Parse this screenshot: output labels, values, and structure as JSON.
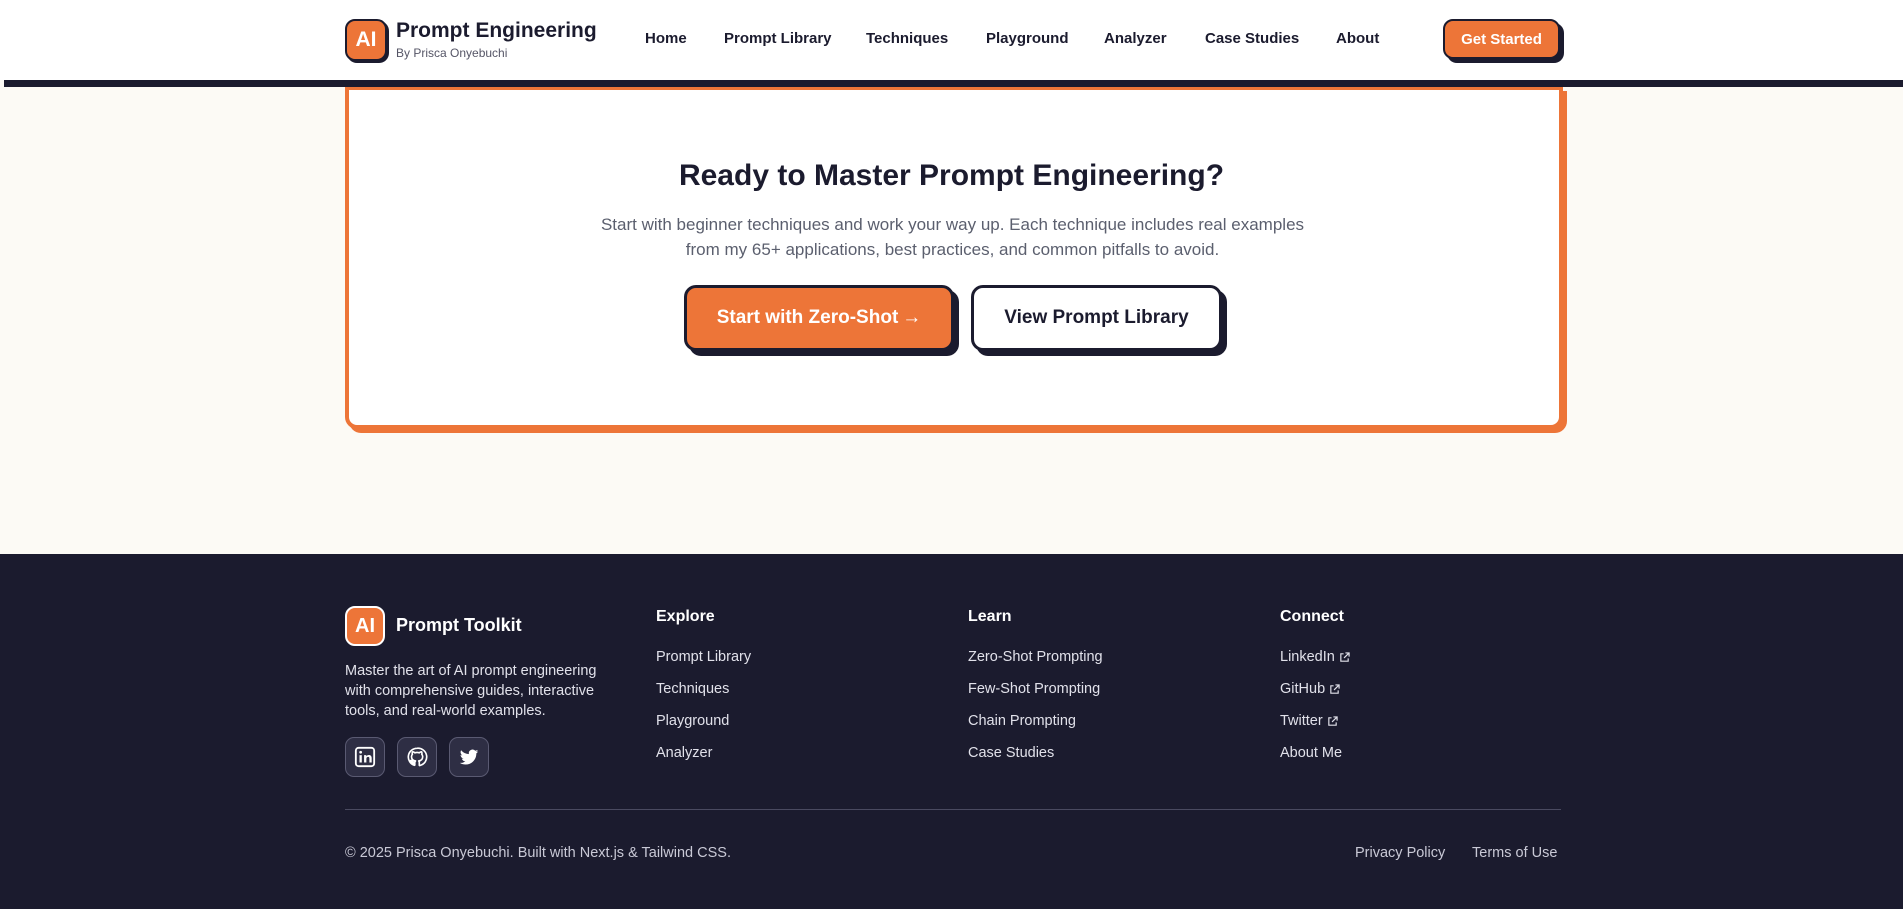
{
  "header": {
    "logo_text": "AI",
    "brand_title": "Prompt Engineering",
    "brand_subtitle": "By Prisca Onyebuchi",
    "nav": [
      "Home",
      "Prompt Library",
      "Techniques",
      "Playground",
      "Analyzer",
      "Case Studies",
      "About"
    ],
    "cta_label": "Get Started"
  },
  "cta_card": {
    "title": "Ready to Master Prompt Engineering?",
    "description": "Start with beginner techniques and work your way up. Each technique includes real examples from my 65+ applications, best practices, and common pitfalls to avoid.",
    "primary_label": "Start with Zero-Shot",
    "primary_arrow": "→",
    "secondary_label": "View Prompt Library"
  },
  "footer": {
    "logo_text": "AI",
    "brand": "Prompt Toolkit",
    "description": "Master the art of AI prompt engineering with comprehensive guides, interactive tools, and real-world examples.",
    "social_icons": [
      "linkedin-icon",
      "github-icon",
      "twitter-icon"
    ],
    "columns": [
      {
        "heading": "Explore",
        "links": [
          "Prompt Library",
          "Techniques",
          "Playground",
          "Analyzer"
        ]
      },
      {
        "heading": "Learn",
        "links": [
          "Zero-Shot Prompting",
          "Few-Shot Prompting",
          "Chain Prompting",
          "Case Studies"
        ]
      },
      {
        "heading": "Connect",
        "links": [
          "LinkedIn",
          "GitHub",
          "Twitter",
          "About Me"
        ]
      }
    ],
    "copyright": "© 2025 Prisca Onyebuchi. Built with Next.js & Tailwind CSS.",
    "legal": [
      "Privacy Policy",
      "Terms of Use"
    ]
  },
  "colors": {
    "accent": "#ed7538",
    "dark": "#1b1b2e",
    "page_bg": "#fcfaf5"
  }
}
